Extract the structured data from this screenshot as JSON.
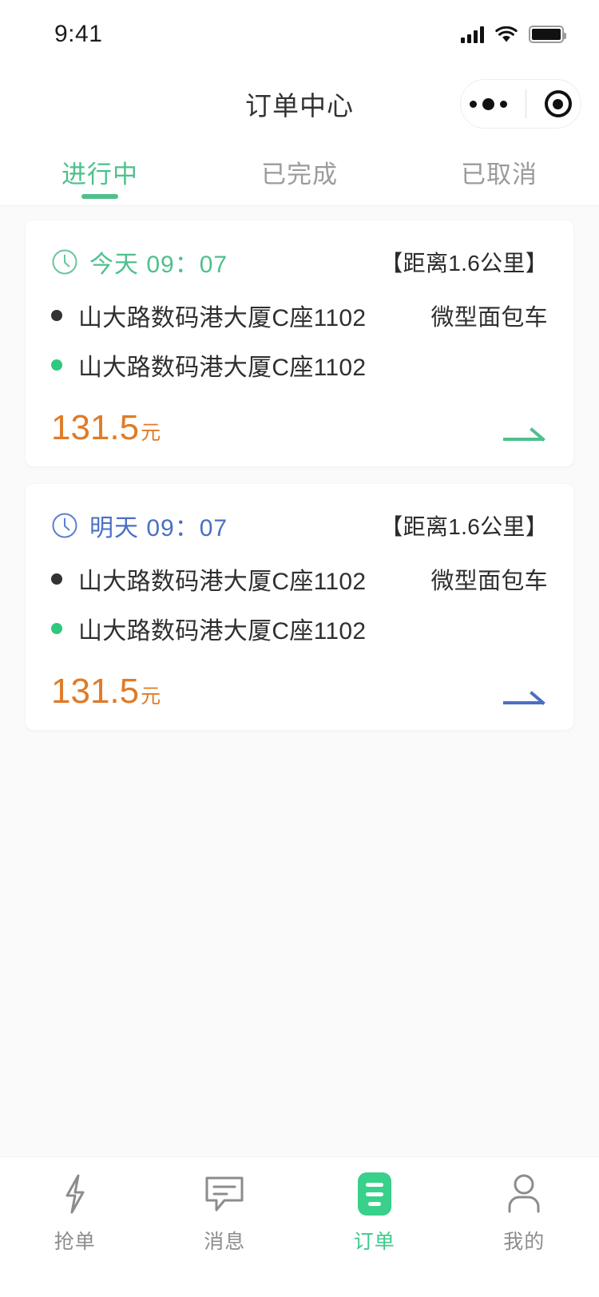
{
  "status_bar": {
    "time": "9:41",
    "signal_icon": "signal-bars-icon",
    "wifi_icon": "wifi-icon",
    "battery_icon": "battery-full-icon"
  },
  "navbar": {
    "title": "订单中心",
    "capsule": {
      "more_icon": "more-dots-icon",
      "target_icon": "target-circle-icon"
    }
  },
  "tabs": {
    "items": [
      {
        "label": "进行中",
        "active": true
      },
      {
        "label": "已完成",
        "active": false
      },
      {
        "label": "已取消",
        "active": false
      }
    ],
    "active_color": "#4ec08c",
    "inactive_color": "#9b9b9b"
  },
  "orders": [
    {
      "clock_icon": "clock-icon",
      "time_label": "今天 09：07",
      "distance": "【距离1.6公里】",
      "pickup_address": "山大路数码港大厦C座1102",
      "dropoff_address": "山大路数码港大厦C座1102",
      "vehicle_type": "微型面包车",
      "price": "131.5",
      "price_unit": "元",
      "arrow_icon": "arrow-right-icon",
      "accent_color": "#4ec08c"
    },
    {
      "clock_icon": "clock-icon",
      "time_label": "明天 09：07",
      "distance": "【距离1.6公里】",
      "pickup_address": "山大路数码港大厦C座1102",
      "dropoff_address": "山大路数码港大厦C座1102",
      "vehicle_type": "微型面包车",
      "price": "131.5",
      "price_unit": "元",
      "arrow_icon": "arrow-right-icon",
      "accent_color": "#4a6fc4"
    }
  ],
  "tabbar": {
    "items": [
      {
        "label": "抢单",
        "icon": "lightning-bolt-icon",
        "active": false
      },
      {
        "label": "消息",
        "icon": "chat-bubble-icon",
        "active": false
      },
      {
        "label": "订单",
        "icon": "order-list-icon",
        "active": true
      },
      {
        "label": "我的",
        "icon": "person-icon",
        "active": false
      }
    ],
    "active_color": "#3fc98a",
    "inactive_color": "#8c8c8c"
  },
  "theme": {
    "page_background": "#fafafa",
    "card_background": "#ffffff",
    "price_color": "#e07b28",
    "pickup_dot_color": "#333333",
    "dropoff_dot_color": "#2ec87f"
  }
}
